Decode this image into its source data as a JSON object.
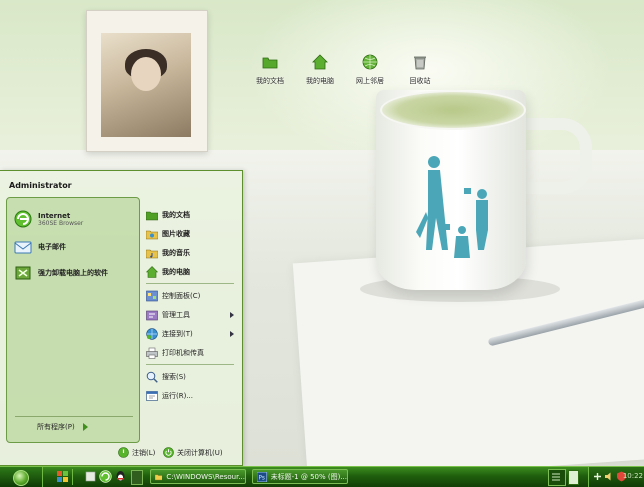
{
  "desktop": {
    "icons": [
      {
        "label": "我的文档",
        "icon": "folder-icon"
      },
      {
        "label": "我的电脑",
        "icon": "computer-icon"
      },
      {
        "label": "网上邻居",
        "icon": "network-icon"
      },
      {
        "label": "回收站",
        "icon": "recycle-bin-icon"
      }
    ]
  },
  "start_menu": {
    "user_name": "Administrator",
    "pinned": [
      {
        "title": "Internet",
        "subtitle": "360SE Browser",
        "icon": "browser-icon"
      },
      {
        "title": "电子邮件",
        "subtitle": "",
        "icon": "email-icon"
      },
      {
        "title": "强力卸载电脑上的软件",
        "subtitle": "",
        "icon": "uninstall-icon"
      }
    ],
    "all_programs": "所有程序(P)",
    "right_items": [
      {
        "label": "我的文档",
        "bold": true,
        "submenu": false,
        "icon": "documents-icon"
      },
      {
        "label": "图片收藏",
        "bold": true,
        "submenu": false,
        "icon": "pictures-icon"
      },
      {
        "label": "我的音乐",
        "bold": true,
        "submenu": false,
        "icon": "music-icon"
      },
      {
        "label": "我的电脑",
        "bold": true,
        "submenu": false,
        "icon": "computer-icon"
      },
      {
        "label": "控制面板(C)",
        "bold": false,
        "submenu": false,
        "icon": "control-panel-icon"
      },
      {
        "label": "管理工具",
        "bold": false,
        "submenu": true,
        "icon": "admin-tools-icon"
      },
      {
        "label": "连接到(T)",
        "bold": false,
        "submenu": true,
        "icon": "connect-icon"
      },
      {
        "label": "打印机和传真",
        "bold": false,
        "submenu": false,
        "icon": "printer-icon"
      },
      {
        "label": "搜索(S)",
        "bold": false,
        "submenu": false,
        "icon": "search-icon"
      },
      {
        "label": "运行(R)...",
        "bold": false,
        "submenu": false,
        "icon": "run-icon"
      }
    ],
    "logoff": "注销(L)",
    "shutdown": "关闭计算机(U)"
  },
  "taskbar": {
    "tasks": [
      {
        "label": "C:\\WINDOWS\\Resour...",
        "icon": "folder-icon"
      },
      {
        "label": "未标题-1 @ 50% (图)...",
        "icon": "photoshop-icon"
      }
    ],
    "clock": "10:22"
  },
  "colors": {
    "taskbar": "#1f5e0d",
    "accent": "#3f8f1c",
    "menu_border": "#5e8f2f"
  }
}
